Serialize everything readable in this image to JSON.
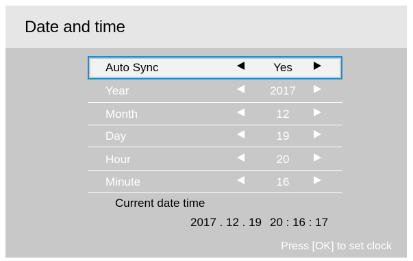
{
  "title": "Date and time",
  "settings": [
    {
      "label": "Auto Sync",
      "value": "Yes"
    },
    {
      "label": "Year",
      "value": "2017"
    },
    {
      "label": "Month",
      "value": "12"
    },
    {
      "label": "Day",
      "value": "19"
    },
    {
      "label": "Hour",
      "value": "20"
    },
    {
      "label": "Minute",
      "value": "16"
    }
  ],
  "current": {
    "label": "Current date time",
    "date": "2017 . 12 . 19",
    "time": "20 : 16 : 17"
  },
  "hint": "Press [OK] to set clock",
  "colors": {
    "panel": "#c8c8c8",
    "header": "#e6e6e6",
    "selection_border": "#1e8cc8",
    "selected_row": "#f2f2f2"
  },
  "icons": {
    "decrease": "triangle-left",
    "increase": "triangle-right"
  }
}
